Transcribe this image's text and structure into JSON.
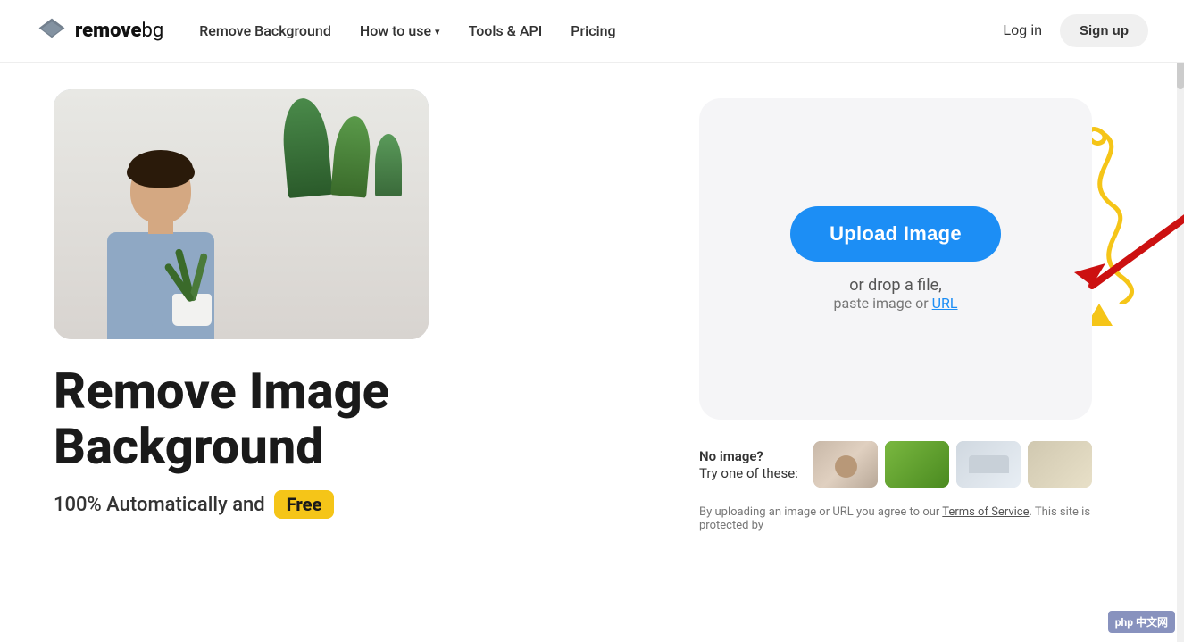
{
  "site": {
    "name_bold": "remove",
    "name_light": "bg"
  },
  "nav": {
    "remove_background_label": "Remove Background",
    "how_to_use_label": "How to use",
    "tools_api_label": "Tools & API",
    "pricing_label": "Pricing",
    "login_label": "Log in",
    "signup_label": "Sign up"
  },
  "hero": {
    "headline_line1": "Remove Image",
    "headline_line2": "Background",
    "sub_text": "100% Automatically and",
    "badge_text": "Free"
  },
  "upload": {
    "button_label": "Upload Image",
    "drop_text": "or drop a file,",
    "paste_text": "paste image or",
    "url_link_text": "URL"
  },
  "samples": {
    "no_image_text": "No image?",
    "try_text": "Try one of these:"
  },
  "footer": {
    "tos_text": "By uploading an image or URL you agree to our",
    "tos_link": "Terms of Service",
    "tos_suffix": ". This site is protected by"
  }
}
